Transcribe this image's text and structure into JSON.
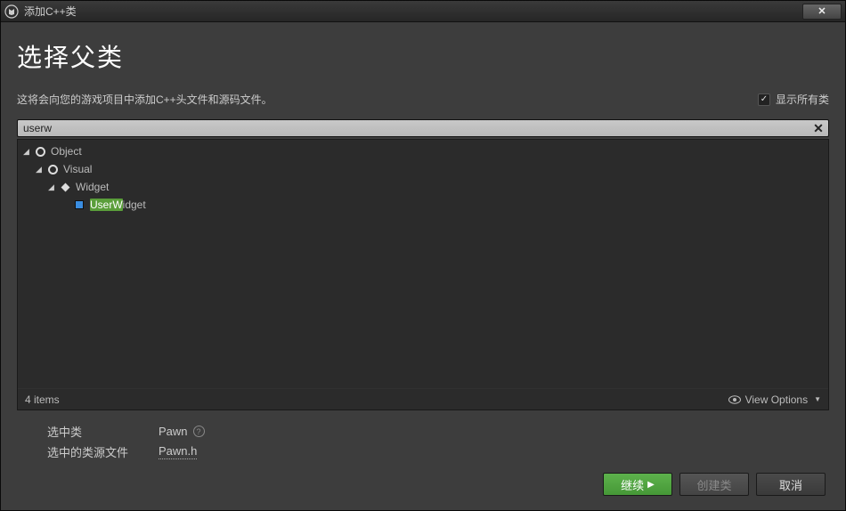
{
  "titlebar": {
    "title": "添加C++类"
  },
  "page": {
    "heading": "选择父类",
    "description": "这将会向您的游戏项目中添加C++头文件和源码文件。"
  },
  "show_all": {
    "label": "显示所有类",
    "checked": true
  },
  "search": {
    "value": "userw"
  },
  "tree": {
    "items": [
      {
        "label": "Object",
        "depth": 1,
        "icon": "circle",
        "expanded": true
      },
      {
        "label": "Visual",
        "depth": 2,
        "icon": "circle",
        "expanded": true
      },
      {
        "label": "Widget",
        "depth": 3,
        "icon": "diamond",
        "expanded": true
      },
      {
        "label": "UserWidget",
        "depth": 4,
        "icon": "square",
        "expanded": false,
        "highlight_len": 5
      }
    ],
    "count_label": "4 items",
    "view_options_label": "View Options"
  },
  "info": {
    "selected_class_label": "选中类",
    "selected_class_value": "Pawn",
    "selected_source_label": "选中的类源文件",
    "selected_source_value": "Pawn.h"
  },
  "buttons": {
    "continue": "继续",
    "create": "创建类",
    "cancel": "取消"
  }
}
